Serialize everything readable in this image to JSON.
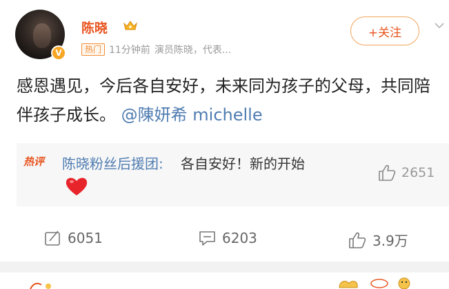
{
  "post": {
    "username": "陈晓",
    "hot_tag": "热门",
    "time": "11分钟前",
    "description": "演员陈晓，代表...",
    "follow_label": "+关注",
    "content_text": "感恩遇见，今后各自安好，未来同为孩子的父母，共同陪伴孩子成长。",
    "mention": "@陳妍希 michelle"
  },
  "hot_comment": {
    "label": "热评",
    "author": "陈晓粉丝后援团:",
    "text": "各自安好！新的开始",
    "likes": "2651"
  },
  "actions": {
    "repost_count": "6051",
    "comment_count": "6203",
    "like_count": "3.9万"
  },
  "colors": {
    "accent_orange": "#e8541e",
    "link_blue": "#4f7cb1",
    "heart_red": "#e8242b"
  }
}
